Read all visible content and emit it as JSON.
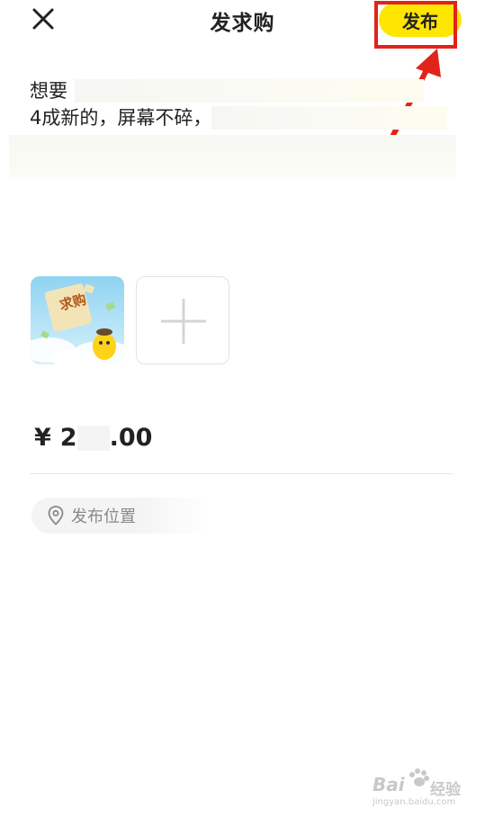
{
  "header": {
    "title": "发求购",
    "publish_label": "发布"
  },
  "description": {
    "line1_prefix": "想要",
    "line2_prefix": "4成新的，屏幕不碎，"
  },
  "price": {
    "currency": "¥",
    "value_start": "2",
    "value_end": ".00"
  },
  "location": {
    "label": "发布位置"
  },
  "thumbnail": {
    "badge_text": "求购"
  },
  "watermark": {
    "brand": "Bai",
    "brand_suffix": "经验",
    "url": "jingyan.baidu.com"
  },
  "colors": {
    "accent": "#ffe600",
    "annotation_red": "#e2231a"
  }
}
